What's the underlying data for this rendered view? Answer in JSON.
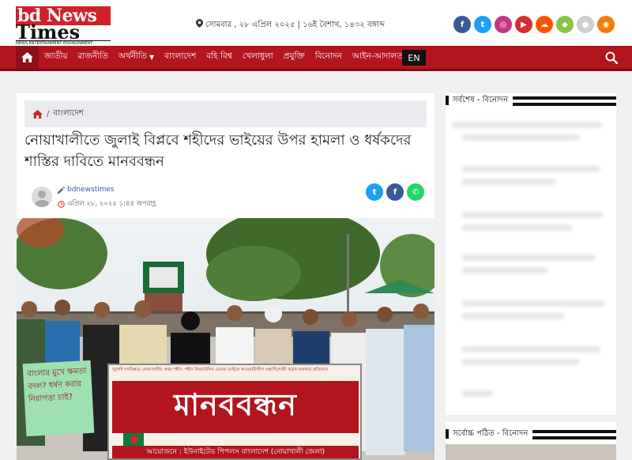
{
  "logo": {
    "line1": "bd News",
    "line2": "Times",
    "tagline": "NEWS ENTERTAINMENT ENVIRONMENT"
  },
  "date": "সোমবার , ২৮ এপ্রিল ২০২৫ | ১৬ই বৈশাখ, ১৪৩২ বঙ্গাব্দ",
  "social": [
    {
      "name": "facebook",
      "glyph": "f",
      "color": "#3b5998"
    },
    {
      "name": "twitter",
      "glyph": "t",
      "color": "#1da1f2"
    },
    {
      "name": "instagram",
      "glyph": "◎",
      "color": "#c13584"
    },
    {
      "name": "youtube",
      "glyph": "▶",
      "color": "#d32f2f"
    },
    {
      "name": "soundcloud",
      "glyph": "☁",
      "color": "#ff5500"
    },
    {
      "name": "android",
      "glyph": "◆",
      "color": "#8bc34a"
    },
    {
      "name": "apple",
      "glyph": "●",
      "color": "#cfcfcf"
    },
    {
      "name": "rss",
      "glyph": "◉",
      "color": "#f57c00"
    }
  ],
  "nav": {
    "items": [
      "জাতীয়",
      "রাজনীতি",
      "অর্থনীতি",
      "বাংলাদেশ",
      "বহি বিশ্ব",
      "খেলাধুলা",
      "প্রযুক্তি",
      "বিনোদন",
      "আইন-আদালত"
    ],
    "lang": "EN"
  },
  "breadcrumb": {
    "section": "বাংলাদেশ"
  },
  "article": {
    "title": "নোয়াখালীতে জুলাই বিপ্লবে শহীদের ভাইয়ের উপর হামলা ও ধর্ষকদের শাস্তির দাবিতে মানববন্ধন",
    "author": "bdnewstimes",
    "date": "এপ্রিল ২৮, ২০২৫ ১:৪৪ অপরাহ্ণ"
  },
  "photo": {
    "banner_main": "মানববন্ধন",
    "banner_top": "জুলাই গণবিপ্লবে নোয়াখালীর প্রথম শহীদ- শহীদ নিজাউদ্দিন মেজো ভাইকে আওয়ামীলীগ সন্ত্রাসীগোষ্ঠী কর্তৃক হামলার প্রতিবাদে",
    "banner_bottom": "আয়োজনে : ইউনাইটেড পিপলস বাংলাদেশ (নোয়াখালী জেলা)",
    "placard": "বাংলার মুখে ক্ষমতা বদল? ধর্ষণ করার নিরাপত্তা চাই?"
  },
  "sidebar": {
    "latest_title": "সর্বশেষ - বিনোদন",
    "popular_title": "সর্বোচ্চ পঠিত - বিনোদন"
  },
  "colors": {
    "brand": "#b3151d",
    "nav_dark": "#8f1016"
  }
}
